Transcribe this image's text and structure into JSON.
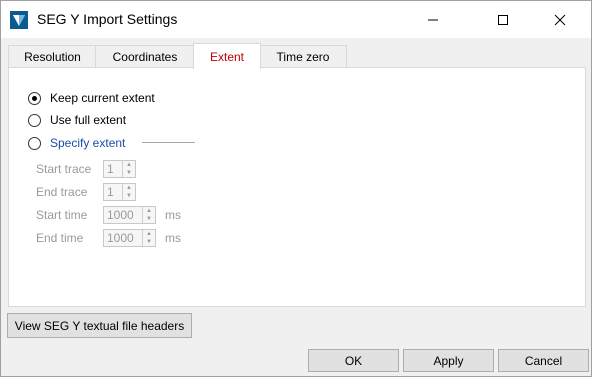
{
  "window": {
    "title": "SEG Y Import Settings",
    "accent": "#0b5b93"
  },
  "tabs": [
    {
      "label": "Resolution"
    },
    {
      "label": "Coordinates"
    },
    {
      "label": "Extent",
      "active": true
    },
    {
      "label": "Time zero"
    }
  ],
  "extent": {
    "options": [
      {
        "label": "Keep current extent",
        "checked": true
      },
      {
        "label": "Use full extent",
        "checked": false
      },
      {
        "label": "Specify extent",
        "checked": false
      }
    ],
    "fields": [
      {
        "label": "Start trace",
        "value": "1",
        "unit": ""
      },
      {
        "label": "End trace",
        "value": "1",
        "unit": ""
      },
      {
        "label": "Start time",
        "value": "1000",
        "unit": "ms"
      },
      {
        "label": "End time",
        "value": "1000",
        "unit": "ms"
      }
    ]
  },
  "buttons": {
    "headers": "View SEG Y textual file headers",
    "ok": "OK",
    "apply": "Apply",
    "cancel": "Cancel"
  }
}
